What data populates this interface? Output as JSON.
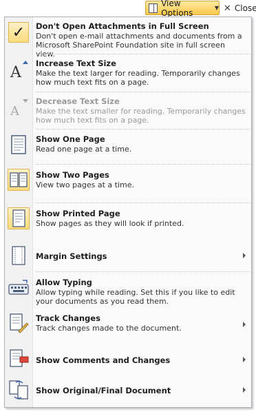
{
  "toolbar": {
    "view_options_label": "View Options",
    "close_label": "Close"
  },
  "menu": {
    "items": [
      {
        "title": "Don't Open Attachments in Full Screen",
        "desc": "Don't open e-mail attachments and documents from a Microsoft SharePoint Foundation site in full screen view."
      },
      {
        "title": "Increase Text Size",
        "desc": "Make the text larger for reading. Temporarily changes how much text fits on a page."
      },
      {
        "title": "Decrease Text Size",
        "desc": "Make the text smaller for reading. Temporarily changes how much text fits on a page."
      },
      {
        "title": "Show One Page",
        "desc": "Read one page at a time."
      },
      {
        "title": "Show Two Pages",
        "desc": "View two pages at a time."
      },
      {
        "title": "Show Printed Page",
        "desc": "Show pages as they will look if printed."
      },
      {
        "title": "Margin Settings",
        "desc": ""
      },
      {
        "title": "Allow Typing",
        "desc": "Allow typing while reading. Set this if you like to edit your documents as you read them."
      },
      {
        "title": "Track Changes",
        "desc": "Track changes made to the document."
      },
      {
        "title": "Show Comments and Changes",
        "desc": ""
      },
      {
        "title": "Show Original/Final Document",
        "desc": ""
      }
    ]
  },
  "colors": {
    "highlight_top": "#fdf1c6",
    "highlight_bottom": "#f9dc7c",
    "highlight_border": "#e0b450",
    "disabled_text": "#9a9a9a"
  }
}
